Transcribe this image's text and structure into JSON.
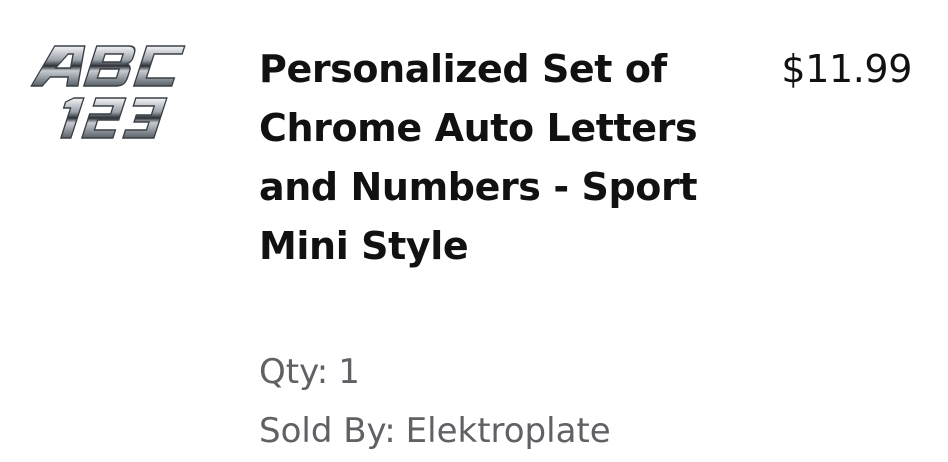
{
  "product": {
    "image_text": "ABC 123",
    "title": "Personalized Set of Chrome Auto Letters and Numbers - Sport Mini Style",
    "price": "$11.99",
    "qty_label": "Qty:",
    "qty_value": "1",
    "seller_label": "Sold By:",
    "seller_name": "Elektroplate"
  },
  "colors": {
    "title": "#111111",
    "meta": "#5f6165",
    "chrome_light": "#e9ecef",
    "chrome_dark": "#2b2f35"
  }
}
